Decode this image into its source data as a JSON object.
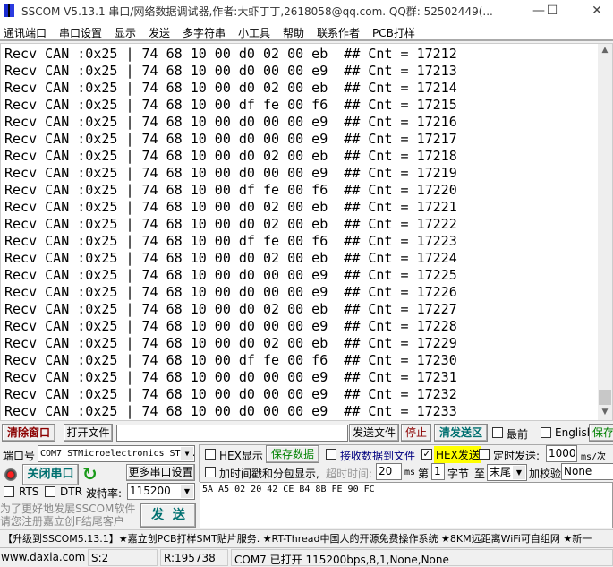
{
  "window": {
    "title": "SSCOM V5.13.1 串口/网络数据调试器,作者:大虾丁丁,2618058@qq.com. QQ群: 52502449(...",
    "minimize": "—",
    "maximize": "☐",
    "close": "✕"
  },
  "menu": [
    "通讯端口",
    "串口设置",
    "显示",
    "发送",
    "多字符串",
    "小工具",
    "帮助",
    "联系作者",
    "PCB打样"
  ],
  "receive_lines": [
    "Recv CAN :0x25 | 74 68 10 00 d0 02 00 eb  ## Cnt = 17212",
    "Recv CAN :0x25 | 74 68 10 00 d0 00 00 e9  ## Cnt = 17213",
    "Recv CAN :0x25 | 74 68 10 00 d0 02 00 eb  ## Cnt = 17214",
    "Recv CAN :0x25 | 74 68 10 00 df fe 00 f6  ## Cnt = 17215",
    "Recv CAN :0x25 | 74 68 10 00 d0 00 00 e9  ## Cnt = 17216",
    "Recv CAN :0x25 | 74 68 10 00 d0 00 00 e9  ## Cnt = 17217",
    "Recv CAN :0x25 | 74 68 10 00 d0 02 00 eb  ## Cnt = 17218",
    "Recv CAN :0x25 | 74 68 10 00 d0 00 00 e9  ## Cnt = 17219",
    "Recv CAN :0x25 | 74 68 10 00 df fe 00 f6  ## Cnt = 17220",
    "Recv CAN :0x25 | 74 68 10 00 d0 02 00 eb  ## Cnt = 17221",
    "Recv CAN :0x25 | 74 68 10 00 d0 02 00 eb  ## Cnt = 17222",
    "Recv CAN :0x25 | 74 68 10 00 df fe 00 f6  ## Cnt = 17223",
    "Recv CAN :0x25 | 74 68 10 00 d0 02 00 eb  ## Cnt = 17224",
    "Recv CAN :0x25 | 74 68 10 00 d0 00 00 e9  ## Cnt = 17225",
    "Recv CAN :0x25 | 74 68 10 00 d0 00 00 e9  ## Cnt = 17226",
    "Recv CAN :0x25 | 74 68 10 00 d0 02 00 eb  ## Cnt = 17227",
    "Recv CAN :0x25 | 74 68 10 00 d0 00 00 e9  ## Cnt = 17228",
    "Recv CAN :0x25 | 74 68 10 00 d0 02 00 eb  ## Cnt = 17229",
    "Recv CAN :0x25 | 74 68 10 00 df fe 00 f6  ## Cnt = 17230",
    "Recv CAN :0x25 | 74 68 10 00 d0 00 00 e9  ## Cnt = 17231",
    "Recv CAN :0x25 | 74 68 10 00 d0 00 00 e9  ## Cnt = 17232",
    "Recv CAN :0x25 | 74 68 10 00 d0 00 00 e9  ## Cnt = 17233"
  ],
  "toolbar": {
    "clear_window": "清除窗口",
    "open_file": "打开文件",
    "file_path": "",
    "send_file": "发送文件",
    "stop": "停止",
    "clear_send": "清发送区",
    "topmost": "最前",
    "english": "English",
    "save_params": "保存参数"
  },
  "port": {
    "label": "端口号",
    "value": "COM7 STMicroelectronics ST...",
    "close_port": "关闭串口",
    "more_settings": "更多串口设置",
    "rts": "RTS",
    "dtr": "DTR",
    "baud_label": "波特率:",
    "baud": "115200"
  },
  "options": {
    "hex_display": "HEX显示",
    "hex_display_checked": false,
    "save_data": "保存数据",
    "recv_to_file": "接收数据到文件",
    "recv_to_file_checked": false,
    "hex_send": "HEX发送",
    "hex_send_checked": true,
    "timed_send": "定时发送:",
    "timed_send_checked": false,
    "interval": "1000",
    "interval_unit": "ms/次",
    "timestamp": "加时间戳和分包显示,",
    "timestamp_checked": false,
    "timeout_label": "超时时间:",
    "timeout": "20",
    "timeout_unit": "ms",
    "byte_from_label": "第",
    "byte_from": "1",
    "byte_unit": "字节",
    "to_label": "至",
    "to_value": "末尾",
    "checksum_label": "加校验",
    "checksum": "None"
  },
  "send_text": "5A A5 02 20 42 CE B4 8B FE 90 FC",
  "promo": [
    "为了更好地发展SSCOM软件",
    "请您注册嘉立创F结尾客户"
  ],
  "send_button": "发  送",
  "marquee": "【升级到SSCOM5.13.1】★嘉立创PCB打样SMT贴片服务. ★RT-Thread中国人的开源免费操作系统 ★8KM远距离WiFi可自组网 ★新一",
  "status": {
    "website": "www.daxia.com",
    "sent": "S:2",
    "received": "R:195738",
    "port_status": "COM7 已打开  115200bps,8,1,None,None"
  },
  "colors": {
    "clear_button_text": "#8b0000",
    "hex_send_bg": "#ffff00",
    "green_text": "#008000",
    "teal_text": "#007070"
  }
}
